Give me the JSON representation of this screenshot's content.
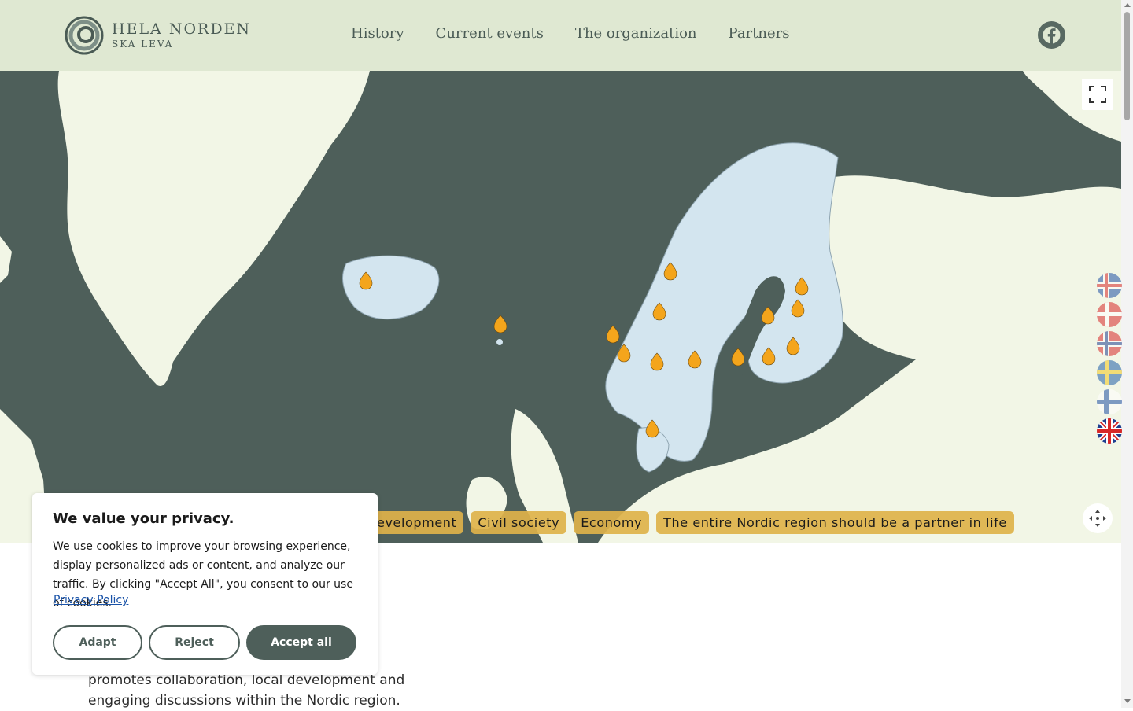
{
  "header": {
    "logo_line1": "HELA NORDEN",
    "logo_line2": "SKA LEVA",
    "nav": [
      {
        "label": "History"
      },
      {
        "label": "Current events"
      },
      {
        "label": "The organization"
      },
      {
        "label": "Partners"
      }
    ],
    "social_icon": "facebook-icon"
  },
  "map": {
    "tags": [
      {
        "label": "evelopment"
      },
      {
        "label": "Civil society"
      },
      {
        "label": "Economy"
      },
      {
        "label": "The entire Nordic region should be a partner in life"
      }
    ],
    "marker_count": 17,
    "controls": [
      "fullscreen-icon",
      "compass-icon"
    ]
  },
  "languages": [
    "Iceland",
    "Denmark",
    "Norway",
    "Sweden",
    "Finland",
    "English"
  ],
  "intro": {
    "line1": "promotes collaboration, local development and",
    "line2": "engaging discussions within the Nordic region."
  },
  "cookie": {
    "title": "We value your privacy.",
    "text": "We use cookies to improve your browsing experience, display personalized ads or content, and analyze our traffic. By clicking \"Accept All\", you consent to our use of cookies.",
    "link": "Privacy Policy",
    "adapt": "Adapt",
    "reject": "Reject",
    "accept": "Accept all"
  },
  "colors": {
    "header_bg": "#dfe8d2",
    "sea": "#4e5f5a",
    "land": "#f2f6e6",
    "nordic": "#d3e5ef",
    "marker": "#f4a51c",
    "tag": "#deb24a",
    "primary": "#4e5f5a"
  }
}
